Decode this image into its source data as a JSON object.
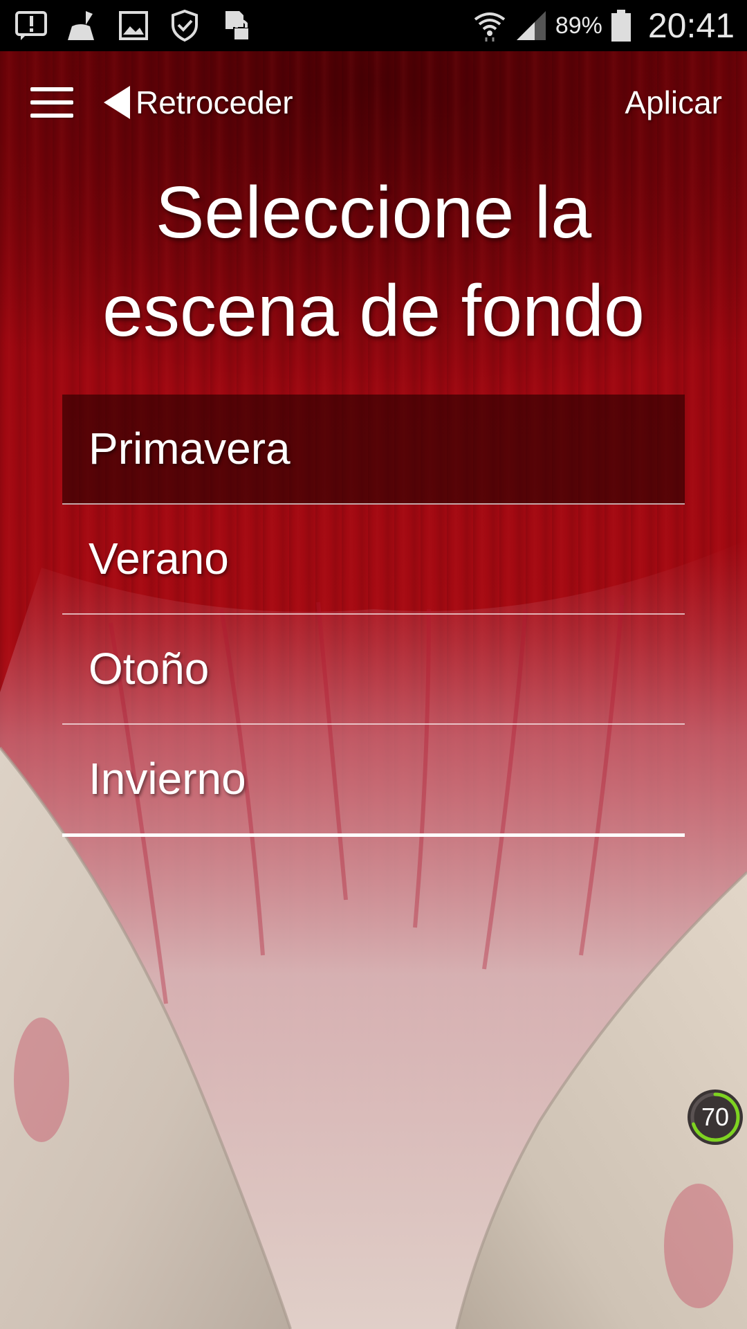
{
  "status_bar": {
    "battery_percent": "89%",
    "clock": "20:41",
    "left_icons": [
      "alert-icon",
      "cleaner-broom-icon",
      "image-icon",
      "shield-check-icon",
      "sd-card-lock-icon"
    ],
    "right_icons": [
      "wifi-icon",
      "signal-icon",
      "battery-icon"
    ]
  },
  "toolbar": {
    "back_label": "Retroceder",
    "apply_label": "Aplicar"
  },
  "title": {
    "line1": "Seleccione la",
    "line2": "escena de fondo"
  },
  "scenes": [
    {
      "label": "Primavera",
      "selected": true
    },
    {
      "label": "Verano",
      "selected": false
    },
    {
      "label": "Otoño",
      "selected": false
    },
    {
      "label": "Invierno",
      "selected": false
    }
  ],
  "floating_badge": {
    "value": "70",
    "ring_color": "#7ed321"
  },
  "colors": {
    "background_red": "#a50a12",
    "selected_row": "#3a0002",
    "text": "#ffffff"
  }
}
